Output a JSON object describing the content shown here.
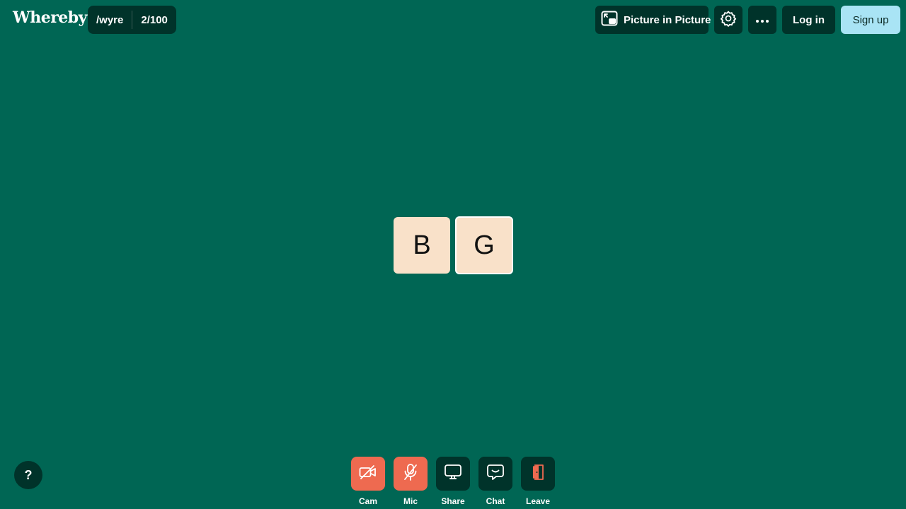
{
  "app": {
    "logo": "Whereby"
  },
  "room": {
    "name": "/wyre",
    "participants": "2/100"
  },
  "header": {
    "pip_label": "Picture in Picture",
    "pip_icon": "picture-in-picture-icon",
    "settings_icon": "gear-icon",
    "more_icon": "more-horizontal-icon",
    "login_label": "Log in",
    "signup_label": "Sign up"
  },
  "participants": [
    {
      "initial": "B"
    },
    {
      "initial": "G"
    }
  ],
  "help": {
    "label": "?"
  },
  "controls": {
    "cam": {
      "label": "Cam",
      "icon": "camera-off-icon",
      "state": "off"
    },
    "mic": {
      "label": "Mic",
      "icon": "mic-off-icon",
      "state": "off"
    },
    "share": {
      "label": "Share",
      "icon": "screen-share-icon"
    },
    "chat": {
      "label": "Chat",
      "icon": "chat-icon"
    },
    "leave": {
      "label": "Leave",
      "icon": "door-exit-icon"
    }
  },
  "colors": {
    "background": "#006654",
    "dark_button": "#00332a",
    "alert_button": "#ee6a50",
    "tile": "#f9e1c9",
    "signup": "#a9e4f5"
  }
}
